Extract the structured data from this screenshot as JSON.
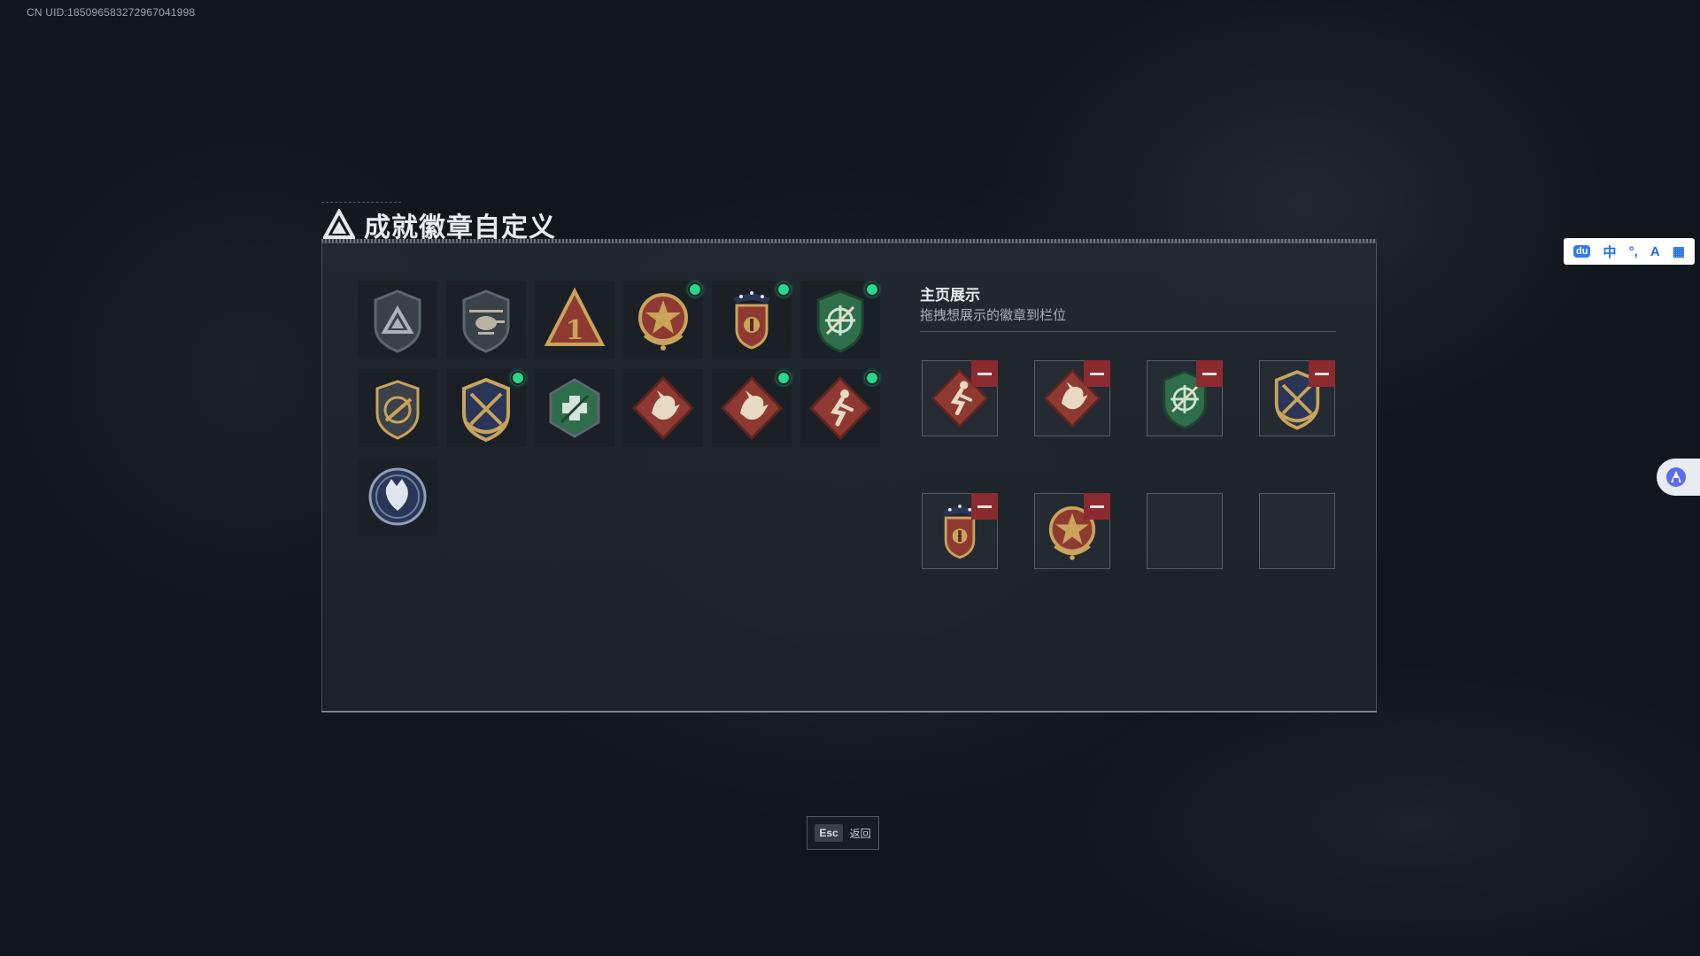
{
  "uid_text": "CN UID:185096583272967041998",
  "title": "成就徽章自定义",
  "showcase": {
    "title": "主页展示",
    "subtitle": "拖拽想展示的徽章到栏位"
  },
  "badges": [
    {
      "icon": "triangle-logo-shield-badge-icon",
      "new": false
    },
    {
      "icon": "helicopter-shield-badge-icon",
      "new": false
    },
    {
      "icon": "number-one-triangle-badge-icon",
      "new": false
    },
    {
      "icon": "star-medal-badge-icon",
      "new": true
    },
    {
      "icon": "red-stars-crest-badge-icon",
      "new": true
    },
    {
      "icon": "green-crosshair-shield-badge-icon",
      "new": true
    },
    {
      "icon": "rifle-shield-badge-icon",
      "new": false
    },
    {
      "icon": "gold-crossed-rifles-badge-icon",
      "new": true
    },
    {
      "icon": "green-hexagon-badge-icon",
      "new": false
    },
    {
      "icon": "dragon-diamond-badge-icon",
      "new": false
    },
    {
      "icon": "dragon-diamond-badge-icon",
      "new": true
    },
    {
      "icon": "runner-diamond-badge-icon",
      "new": true
    },
    {
      "icon": "wolf-circle-badge-icon",
      "new": false
    }
  ],
  "slots": [
    {
      "icon": "runner-diamond-badge-icon",
      "filled": true
    },
    {
      "icon": "dragon-diamond-badge-icon",
      "filled": true
    },
    {
      "icon": "green-crosshair-shield-badge-icon",
      "filled": true
    },
    {
      "icon": "gold-crossed-rifles-badge-icon",
      "filled": true
    },
    {
      "icon": "red-stars-crest-badge-icon",
      "filled": true
    },
    {
      "icon": "star-medal-badge-icon",
      "filled": true
    },
    {
      "icon": "",
      "filled": false
    },
    {
      "icon": "",
      "filled": false
    }
  ],
  "esc": {
    "key": "Esc",
    "label": "返回"
  },
  "ime": {
    "items": [
      "du",
      "中",
      "°,",
      "A",
      "▦"
    ]
  },
  "colors": {
    "new_dot": "#27d98a",
    "remove": "#8b2b2f",
    "panel_border": "#6e7a87"
  }
}
